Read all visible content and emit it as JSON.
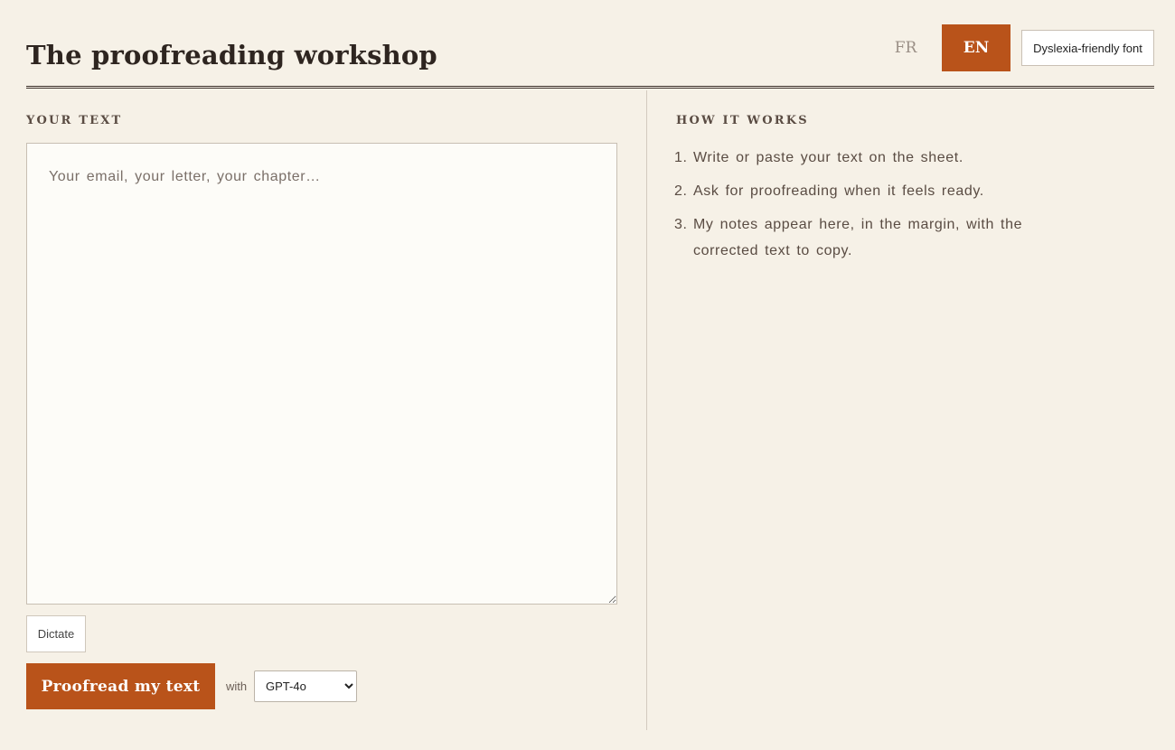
{
  "header": {
    "title": "The proofreading workshop",
    "lang_fr": "FR",
    "lang_en": "EN",
    "active_lang": "EN",
    "dyslexia_button": "Dyslexia-friendly font"
  },
  "editor": {
    "label": "YOUR TEXT",
    "placeholder": "Your email, your letter, your chapter…",
    "value": "",
    "dictate_label": "Dictate",
    "proofread_label": "Proofread my text",
    "with_label": "with",
    "model_selected": "GPT-4o"
  },
  "how": {
    "label": "HOW IT WORKS",
    "steps": [
      {
        "num": "1.",
        "text": "Write or paste your text on the sheet."
      },
      {
        "num": "2.",
        "text": "Ask for proofreading when it feels ready."
      },
      {
        "num": "3.",
        "text": "My notes appear here, in the margin, with the corrected text to copy."
      }
    ]
  },
  "colors": {
    "background": "#f6f1e7",
    "accent": "#b9531a",
    "paper": "#fdfcf8",
    "ink": "#2e2520"
  }
}
